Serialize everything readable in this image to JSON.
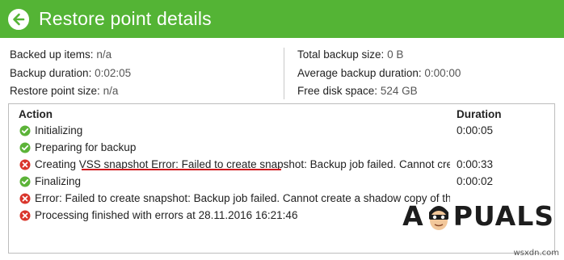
{
  "window": {
    "title": "Restore point details"
  },
  "summary": {
    "left": [
      {
        "label": "Backed up items:",
        "value": "n/a"
      },
      {
        "label": "Backup duration:",
        "value": "0:02:05"
      },
      {
        "label": "Restore point size:",
        "value": "n/a"
      }
    ],
    "right": [
      {
        "label": "Total backup size:",
        "value": "0 B"
      },
      {
        "label": "Average backup duration:",
        "value": "0:00:00"
      },
      {
        "label": "Free disk space:",
        "value": "524 GB"
      }
    ]
  },
  "log": {
    "headers": {
      "action": "Action",
      "duration": "Duration"
    },
    "rows": [
      {
        "status": "success",
        "action": "Initializing",
        "duration": "0:00:05"
      },
      {
        "status": "success",
        "action": "Preparing for backup",
        "duration": ""
      },
      {
        "status": "error",
        "action": "Creating VSS snapshot Error: Failed to create snapshot: Backup job failed. Cannot creat",
        "duration": "0:00:33"
      },
      {
        "status": "success",
        "action": "Finalizing",
        "duration": "0:00:02"
      },
      {
        "status": "error",
        "action": "Error: Failed to create snapshot: Backup job failed. Cannot create a shadow copy of the",
        "duration": ""
      },
      {
        "status": "error",
        "action": "Processing finished with errors at 28.11.2016 16:21:46",
        "duration": ""
      }
    ]
  },
  "watermark": {
    "text_a": "A",
    "text_rest": "PUALS",
    "source": "wsxdn.com"
  },
  "colors": {
    "titlebar": "#54b435",
    "success": "#5cb338",
    "error": "#d9352b",
    "annotation": "#d0161c"
  }
}
